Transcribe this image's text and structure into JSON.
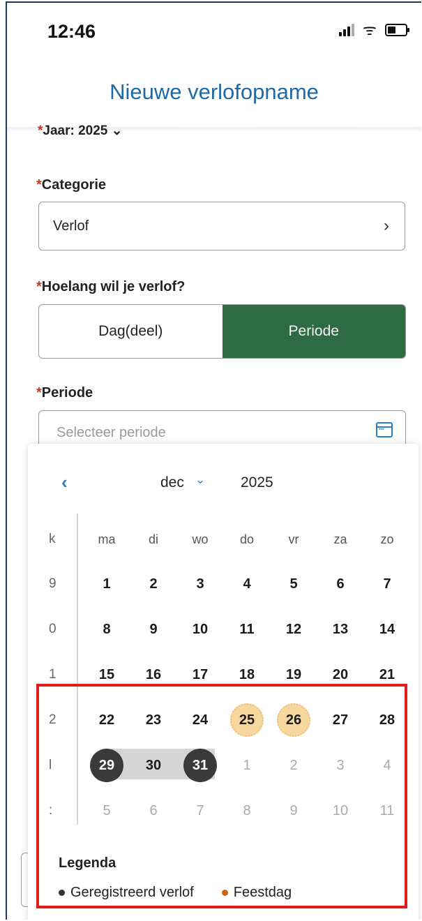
{
  "status": {
    "time": "12:46"
  },
  "header": {
    "title": "Nieuwe verlofopname"
  },
  "form": {
    "year_label": "Jaar: 2025",
    "category_label": "Categorie",
    "category_value": "Verlof",
    "duration_label": "Hoelang wil je verlof?",
    "duration_options": [
      "Dag(deel)",
      "Periode"
    ],
    "duration_selected": "Periode",
    "period_label": "Periode",
    "period_placeholder": "Selecteer periode"
  },
  "calendar": {
    "month": "dec",
    "year": "2025",
    "week_header": "k",
    "weekdays": [
      "ma",
      "di",
      "wo",
      "do",
      "vr",
      "za",
      "zo"
    ],
    "weeks": [
      {
        "wk": "9",
        "days": [
          "1",
          "2",
          "3",
          "4",
          "5",
          "6",
          "7"
        ]
      },
      {
        "wk": "0",
        "days": [
          "8",
          "9",
          "10",
          "11",
          "12",
          "13",
          "14"
        ]
      },
      {
        "wk": "1",
        "days": [
          "15",
          "16",
          "17",
          "18",
          "19",
          "20",
          "21"
        ]
      },
      {
        "wk": "2",
        "days": [
          "22",
          "23",
          "24",
          "25",
          "26",
          "27",
          "28"
        ]
      },
      {
        "wk": "l",
        "days": [
          "29",
          "30",
          "31",
          "1",
          "2",
          "3",
          "4"
        ]
      },
      {
        "wk": ":",
        "days": [
          "5",
          "6",
          "7",
          "8",
          "9",
          "10",
          "11"
        ]
      }
    ],
    "selected_range": [
      "29",
      "31"
    ],
    "holidays": [
      "25",
      "26"
    ]
  },
  "legend": {
    "title": "Legenda",
    "items": [
      {
        "label": "Geregistreerd verlof",
        "color": "#333333"
      },
      {
        "label": "Feestdag",
        "color": "#c8650c"
      }
    ]
  },
  "colors": {
    "accent": "#2e6b45",
    "title": "#1d6aa8",
    "required": "#c0392b",
    "highlight": "#e21b1b"
  }
}
